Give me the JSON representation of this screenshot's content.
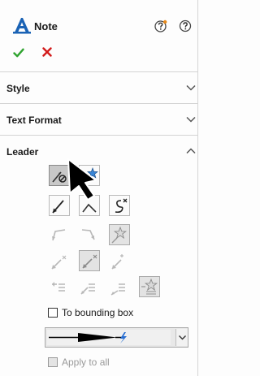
{
  "header": {
    "title": "Note",
    "app_icon": "note-a-icon",
    "help_icons": [
      "whats-wrong-help-icon",
      "help-icon"
    ],
    "ok_icon": "checkmark-icon",
    "cancel_icon": "x-icon",
    "colors": {
      "accent": "#1b63b5",
      "ok": "#2fa32f",
      "cancel": "#d21a1a"
    }
  },
  "sections": [
    {
      "label": "Style",
      "state": "collapsed"
    },
    {
      "label": "Text Format",
      "state": "collapsed"
    },
    {
      "label": "Leader",
      "state": "expanded"
    }
  ],
  "leader": {
    "bounding_box": {
      "label": "To bounding box",
      "checked": false
    },
    "style_combo": {
      "selected": "solid line with filled arrow"
    },
    "apply_to_all": {
      "label": "Apply to all",
      "checked": false,
      "enabled": false
    }
  }
}
